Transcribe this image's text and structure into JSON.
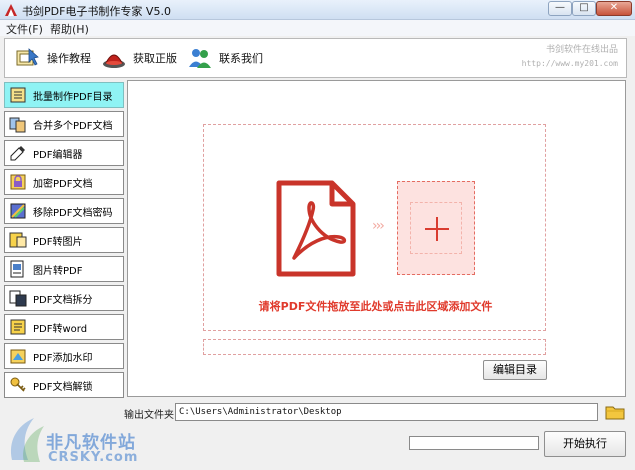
{
  "window": {
    "title": "书剑PDF电子书制作专家 V5.0",
    "minimize_glyph": "—",
    "maximize_glyph": "□",
    "close_glyph": "✕"
  },
  "menu": [
    {
      "label": "文件(F)"
    },
    {
      "label": "帮助(H)"
    }
  ],
  "toolbar": {
    "buttons": [
      {
        "label": "操作教程",
        "icon": "tutorial-icon"
      },
      {
        "label": "获取正版",
        "icon": "purchase-icon"
      },
      {
        "label": "联系我们",
        "icon": "contact-icon"
      }
    ],
    "brand_name": "书剑软件在线出品",
    "brand_url": "http://www.my201.com"
  },
  "sidebar": {
    "items": [
      {
        "label": "批量制作PDF目录",
        "icon": "batch-toc-icon",
        "active": true
      },
      {
        "label": "合并多个PDF文档",
        "icon": "merge-icon"
      },
      {
        "label": "PDF编辑器",
        "icon": "editor-icon"
      },
      {
        "label": "加密PDF文档",
        "icon": "encrypt-icon"
      },
      {
        "label": "移除PDF文档密码",
        "icon": "remove-password-icon"
      },
      {
        "label": "PDF转图片",
        "icon": "pdf-to-image-icon"
      },
      {
        "label": "图片转PDF",
        "icon": "image-to-pdf-icon"
      },
      {
        "label": "PDF文档拆分",
        "icon": "split-icon"
      },
      {
        "label": "PDF转word",
        "icon": "pdf-to-word-icon"
      },
      {
        "label": "PDF添加水印",
        "icon": "watermark-icon"
      },
      {
        "label": "PDF文档解锁",
        "icon": "unlock-icon"
      }
    ]
  },
  "dropzone": {
    "arrows": "›››",
    "hint": "请将PDF文件拖放至此处或点击此区域添加文件"
  },
  "edit_button": "编辑目录",
  "output": {
    "label": "输出文件夹",
    "value": "C:\\Users\\Administrator\\Desktop"
  },
  "progress": {
    "value": 0
  },
  "start_button": "开始执行",
  "watermark": {
    "cn": "非凡软件站",
    "en": "CRSKY.com"
  },
  "colors": {
    "accent": "#e03a2c",
    "active_item": "#8ff3f4",
    "pdf_red": "#c9342a"
  }
}
